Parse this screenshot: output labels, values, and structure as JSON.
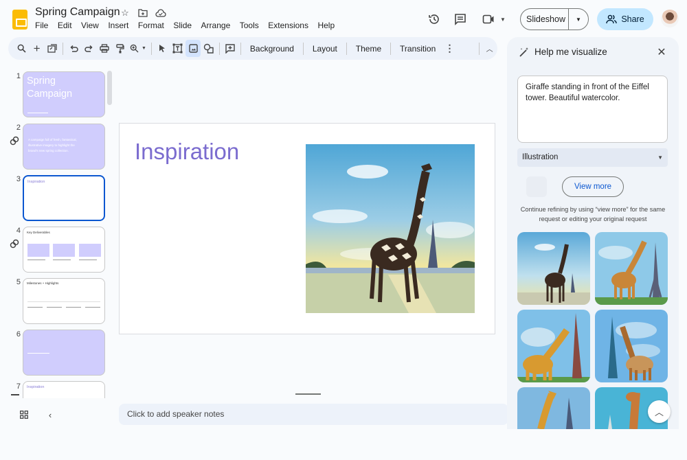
{
  "app": {
    "doc_title": "Spring Campaign",
    "title_icons": [
      "star-icon",
      "move-to-folder-icon",
      "cloud-saved-icon"
    ],
    "menu": [
      "File",
      "Edit",
      "View",
      "Insert",
      "Format",
      "Slide",
      "Arrange",
      "Tools",
      "Extensions",
      "Help"
    ]
  },
  "header": {
    "slideshow_label": "Slideshow",
    "share_label": "Share"
  },
  "toolbar": {
    "background": "Background",
    "layout": "Layout",
    "theme": "Theme",
    "transition": "Transition"
  },
  "filmstrip": {
    "slides": [
      {
        "num": "1",
        "title": "Spring Campaign",
        "style": "lavender"
      },
      {
        "num": "2",
        "text": "A campaign full of fresh, fantastical, illustrative imagery to highlight the brand's new spring collection.",
        "style": "lavender",
        "linked": true
      },
      {
        "num": "3",
        "title": "Inspiration",
        "style": "white",
        "selected": true
      },
      {
        "num": "4",
        "title": "Key Deliverables",
        "style": "white",
        "linked": true
      },
      {
        "num": "5",
        "title": "Milestones + Highlights",
        "style": "white"
      },
      {
        "num": "6",
        "title": "",
        "style": "lavender"
      },
      {
        "num": "7",
        "title": "Inspiration",
        "style": "white"
      }
    ]
  },
  "slide": {
    "title": "Inspiration",
    "image_alt": "Giraffe standing in front of the Eiffel tower, watercolor"
  },
  "notes": {
    "placeholder": "Click to add speaker notes"
  },
  "panel": {
    "title": "Help me visualize",
    "prompt": "Giraffe standing in front of the Eiffel tower. Beautiful watercolor.",
    "style_selected": "Illustration",
    "view_more": "View more",
    "hint": "Continue refining by using “view more” for the same request or editing your original request",
    "results_count": 6
  },
  "colors": {
    "accent": "#0b57d0",
    "share_bg": "#c2e7ff",
    "slide_title": "#7b6ccf",
    "lavender": "#d0cdfd",
    "logo": "#fbbc04"
  }
}
